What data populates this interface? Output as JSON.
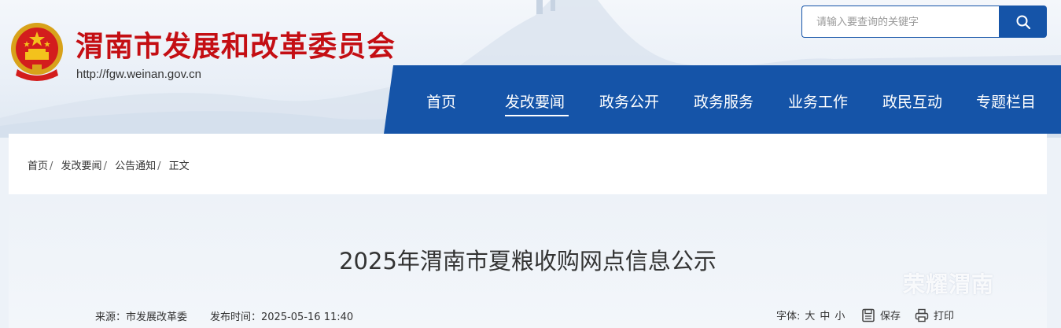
{
  "header": {
    "site_title": "渭南市发展和改革委员会",
    "site_url": "http://fgw.weinan.gov.cn",
    "search_placeholder": "请输入要查询的关键字"
  },
  "nav": {
    "items": [
      "首页",
      "发改要闻",
      "政务公开",
      "政务服务",
      "业务工作",
      "政民互动",
      "专题栏目"
    ],
    "active": "发改要闻"
  },
  "breadcrumb": [
    "首页",
    "发改要闻",
    "公告通知",
    "正文"
  ],
  "article": {
    "title": "2025年渭南市夏粮收购网点信息公示",
    "source_label": "来源：",
    "source": "市发展改革委",
    "publish_label": "发布时间：",
    "publish_time": "2025-05-16 11:40",
    "font_label": "字体:",
    "font_sizes": [
      "大",
      "中",
      "小"
    ],
    "save_label": "保存",
    "print_label": "打印"
  },
  "watermark": "荣耀渭南",
  "colors": {
    "brand_red": "#c40e13",
    "nav_blue": "#1554a8"
  }
}
